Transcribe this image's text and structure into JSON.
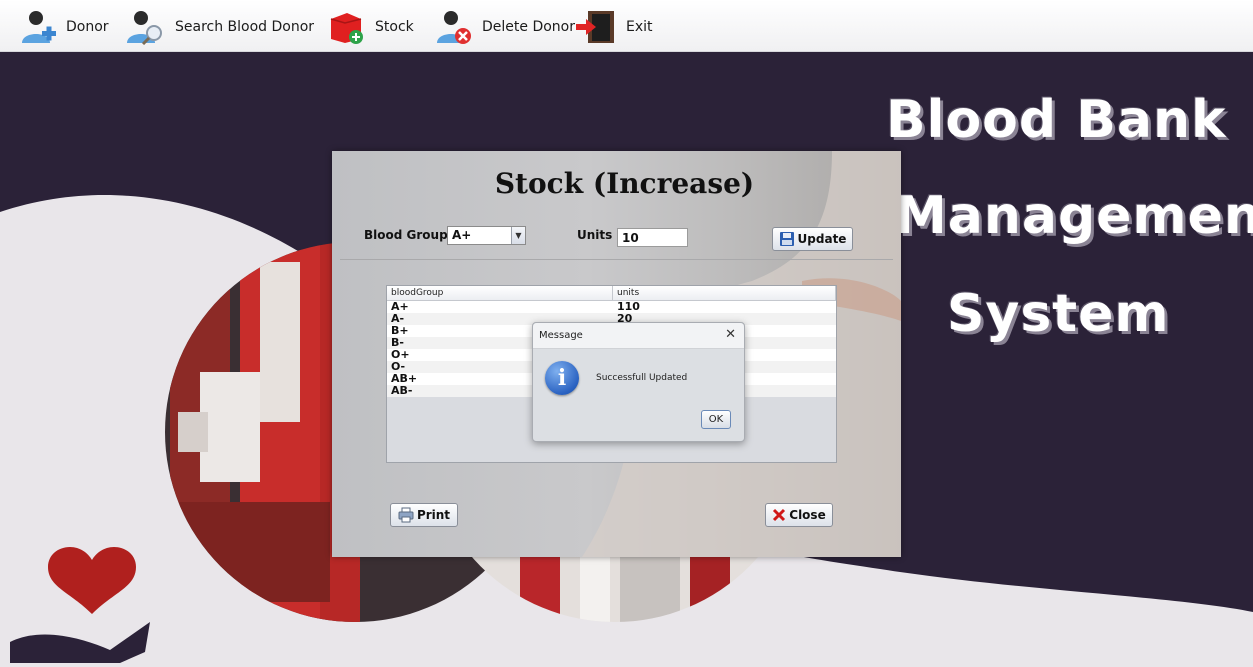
{
  "menubar": {
    "items": [
      {
        "label": "Donor"
      },
      {
        "label": "Search Blood Donor"
      },
      {
        "label": "Stock"
      },
      {
        "label": "Delete Donor"
      },
      {
        "label": "Exit"
      }
    ]
  },
  "background": {
    "title_lines": [
      "Blood Bank",
      "Management",
      "System"
    ]
  },
  "stock": {
    "title": "Stock (Increase)",
    "blood_group_label": "Blood Group",
    "blood_group_value": "A+",
    "units_label": "Units",
    "units_value": "10",
    "update_label": "Update",
    "print_label": "Print",
    "close_label": "Close",
    "table": {
      "columns": [
        "bloodGroup",
        "units"
      ],
      "rows": [
        [
          "A+",
          "110"
        ],
        [
          "A-",
          "20"
        ],
        [
          "B+",
          ""
        ],
        [
          "B-",
          ""
        ],
        [
          "O+",
          ""
        ],
        [
          "O-",
          ""
        ],
        [
          "AB+",
          ""
        ],
        [
          "AB-",
          ""
        ]
      ]
    }
  },
  "dialog": {
    "title": "Message",
    "message": "Successfull Updated",
    "ok_label": "OK",
    "close_symbol": "✕",
    "icon": "info-icon"
  },
  "colors": {
    "background_dark": "#2b2238",
    "background_light": "#e9e6ea",
    "accent_red": "#b0201e"
  }
}
